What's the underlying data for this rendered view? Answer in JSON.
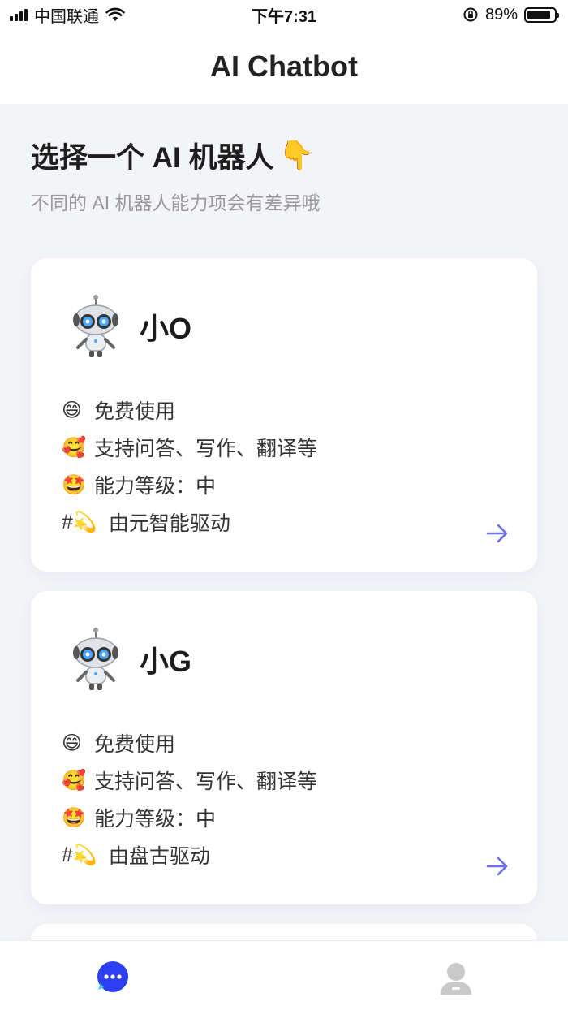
{
  "status_bar": {
    "carrier": "中国联通",
    "time": "下午7:31",
    "battery_text": "89%",
    "battery_level": 0.89
  },
  "header": {
    "title": "AI Chatbot"
  },
  "intro": {
    "title": "选择一个 AI 机器人",
    "title_emoji": "👇",
    "subtitle": "不同的 AI 机器人能力项会有差异哦"
  },
  "bots": [
    {
      "name": "小O",
      "features": [
        {
          "emoji": "😄",
          "text": "免费使用"
        },
        {
          "emoji": "🥰",
          "text": "支持问答、写作、翻译等"
        },
        {
          "emoji": "🤩",
          "text": "能力等级：中"
        }
      ],
      "powered_prefix": "#",
      "powered_emoji": "💫",
      "powered_text": "由元智能驱动"
    },
    {
      "name": "小G",
      "features": [
        {
          "emoji": "😄",
          "text": "免费使用"
        },
        {
          "emoji": "🥰",
          "text": "支持问答、写作、翻译等"
        },
        {
          "emoji": "🤩",
          "text": "能力等级：中"
        }
      ],
      "powered_prefix": "#",
      "powered_emoji": "💫",
      "powered_text": "由盘古驱动"
    }
  ],
  "nav": {
    "items": [
      {
        "icon": "chat-bubble-icon",
        "active": true
      },
      {
        "icon": "profile-icon",
        "active": false
      }
    ]
  },
  "colors": {
    "accent": "#2b3ff0",
    "arrow": "#6a6ef0",
    "inactive": "#c9c9c9"
  }
}
